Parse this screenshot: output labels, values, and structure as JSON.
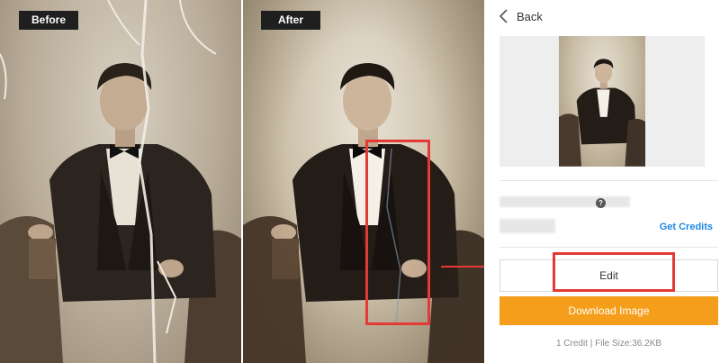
{
  "comparison": {
    "before_label": "Before",
    "after_label": "After"
  },
  "sidebar": {
    "back_label": "Back",
    "get_credits_label": "Get Credits",
    "help_icon_glyph": "?",
    "edit_label": "Edit",
    "download_label": "Download Image",
    "info_text": "1 Credit | File Size:36.2KB"
  },
  "icons": {
    "back": "chevron-left-icon",
    "help": "question-circle-icon",
    "arrow": "right-arrow-icon"
  },
  "colors": {
    "accent_orange": "#f59e1c",
    "link_blue": "#1e88e5",
    "highlight_red": "#e53935",
    "label_bg": "#1f1f1f"
  }
}
